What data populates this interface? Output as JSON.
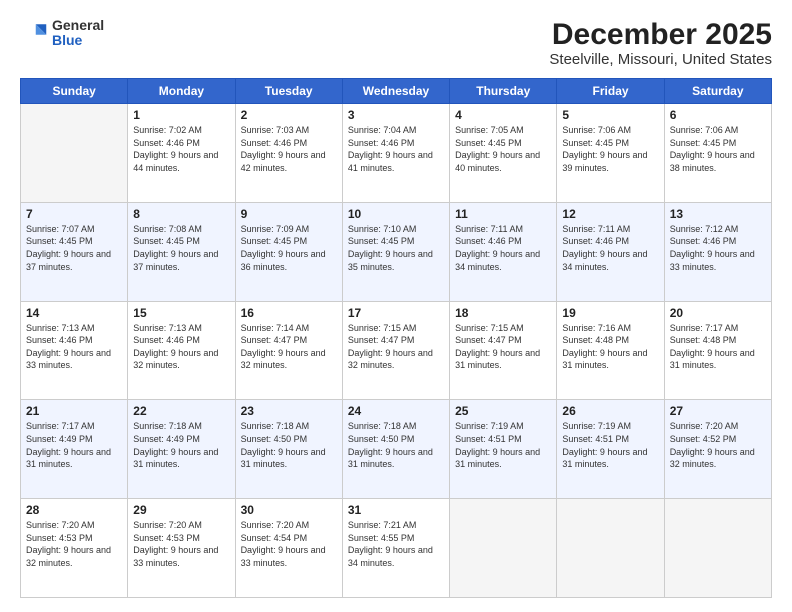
{
  "header": {
    "logo_general": "General",
    "logo_blue": "Blue",
    "title": "December 2025",
    "subtitle": "Steelville, Missouri, United States"
  },
  "days_of_week": [
    "Sunday",
    "Monday",
    "Tuesday",
    "Wednesday",
    "Thursday",
    "Friday",
    "Saturday"
  ],
  "weeks": [
    [
      {
        "day": "",
        "empty": true
      },
      {
        "day": "1",
        "sunrise": "Sunrise: 7:02 AM",
        "sunset": "Sunset: 4:46 PM",
        "daylight": "Daylight: 9 hours and 44 minutes."
      },
      {
        "day": "2",
        "sunrise": "Sunrise: 7:03 AM",
        "sunset": "Sunset: 4:46 PM",
        "daylight": "Daylight: 9 hours and 42 minutes."
      },
      {
        "day": "3",
        "sunrise": "Sunrise: 7:04 AM",
        "sunset": "Sunset: 4:46 PM",
        "daylight": "Daylight: 9 hours and 41 minutes."
      },
      {
        "day": "4",
        "sunrise": "Sunrise: 7:05 AM",
        "sunset": "Sunset: 4:45 PM",
        "daylight": "Daylight: 9 hours and 40 minutes."
      },
      {
        "day": "5",
        "sunrise": "Sunrise: 7:06 AM",
        "sunset": "Sunset: 4:45 PM",
        "daylight": "Daylight: 9 hours and 39 minutes."
      },
      {
        "day": "6",
        "sunrise": "Sunrise: 7:06 AM",
        "sunset": "Sunset: 4:45 PM",
        "daylight": "Daylight: 9 hours and 38 minutes."
      }
    ],
    [
      {
        "day": "7",
        "sunrise": "Sunrise: 7:07 AM",
        "sunset": "Sunset: 4:45 PM",
        "daylight": "Daylight: 9 hours and 37 minutes."
      },
      {
        "day": "8",
        "sunrise": "Sunrise: 7:08 AM",
        "sunset": "Sunset: 4:45 PM",
        "daylight": "Daylight: 9 hours and 37 minutes."
      },
      {
        "day": "9",
        "sunrise": "Sunrise: 7:09 AM",
        "sunset": "Sunset: 4:45 PM",
        "daylight": "Daylight: 9 hours and 36 minutes."
      },
      {
        "day": "10",
        "sunrise": "Sunrise: 7:10 AM",
        "sunset": "Sunset: 4:45 PM",
        "daylight": "Daylight: 9 hours and 35 minutes."
      },
      {
        "day": "11",
        "sunrise": "Sunrise: 7:11 AM",
        "sunset": "Sunset: 4:46 PM",
        "daylight": "Daylight: 9 hours and 34 minutes."
      },
      {
        "day": "12",
        "sunrise": "Sunrise: 7:11 AM",
        "sunset": "Sunset: 4:46 PM",
        "daylight": "Daylight: 9 hours and 34 minutes."
      },
      {
        "day": "13",
        "sunrise": "Sunrise: 7:12 AM",
        "sunset": "Sunset: 4:46 PM",
        "daylight": "Daylight: 9 hours and 33 minutes."
      }
    ],
    [
      {
        "day": "14",
        "sunrise": "Sunrise: 7:13 AM",
        "sunset": "Sunset: 4:46 PM",
        "daylight": "Daylight: 9 hours and 33 minutes."
      },
      {
        "day": "15",
        "sunrise": "Sunrise: 7:13 AM",
        "sunset": "Sunset: 4:46 PM",
        "daylight": "Daylight: 9 hours and 32 minutes."
      },
      {
        "day": "16",
        "sunrise": "Sunrise: 7:14 AM",
        "sunset": "Sunset: 4:47 PM",
        "daylight": "Daylight: 9 hours and 32 minutes."
      },
      {
        "day": "17",
        "sunrise": "Sunrise: 7:15 AM",
        "sunset": "Sunset: 4:47 PM",
        "daylight": "Daylight: 9 hours and 32 minutes."
      },
      {
        "day": "18",
        "sunrise": "Sunrise: 7:15 AM",
        "sunset": "Sunset: 4:47 PM",
        "daylight": "Daylight: 9 hours and 31 minutes."
      },
      {
        "day": "19",
        "sunrise": "Sunrise: 7:16 AM",
        "sunset": "Sunset: 4:48 PM",
        "daylight": "Daylight: 9 hours and 31 minutes."
      },
      {
        "day": "20",
        "sunrise": "Sunrise: 7:17 AM",
        "sunset": "Sunset: 4:48 PM",
        "daylight": "Daylight: 9 hours and 31 minutes."
      }
    ],
    [
      {
        "day": "21",
        "sunrise": "Sunrise: 7:17 AM",
        "sunset": "Sunset: 4:49 PM",
        "daylight": "Daylight: 9 hours and 31 minutes."
      },
      {
        "day": "22",
        "sunrise": "Sunrise: 7:18 AM",
        "sunset": "Sunset: 4:49 PM",
        "daylight": "Daylight: 9 hours and 31 minutes."
      },
      {
        "day": "23",
        "sunrise": "Sunrise: 7:18 AM",
        "sunset": "Sunset: 4:50 PM",
        "daylight": "Daylight: 9 hours and 31 minutes."
      },
      {
        "day": "24",
        "sunrise": "Sunrise: 7:18 AM",
        "sunset": "Sunset: 4:50 PM",
        "daylight": "Daylight: 9 hours and 31 minutes."
      },
      {
        "day": "25",
        "sunrise": "Sunrise: 7:19 AM",
        "sunset": "Sunset: 4:51 PM",
        "daylight": "Daylight: 9 hours and 31 minutes."
      },
      {
        "day": "26",
        "sunrise": "Sunrise: 7:19 AM",
        "sunset": "Sunset: 4:51 PM",
        "daylight": "Daylight: 9 hours and 31 minutes."
      },
      {
        "day": "27",
        "sunrise": "Sunrise: 7:20 AM",
        "sunset": "Sunset: 4:52 PM",
        "daylight": "Daylight: 9 hours and 32 minutes."
      }
    ],
    [
      {
        "day": "28",
        "sunrise": "Sunrise: 7:20 AM",
        "sunset": "Sunset: 4:53 PM",
        "daylight": "Daylight: 9 hours and 32 minutes."
      },
      {
        "day": "29",
        "sunrise": "Sunrise: 7:20 AM",
        "sunset": "Sunset: 4:53 PM",
        "daylight": "Daylight: 9 hours and 33 minutes."
      },
      {
        "day": "30",
        "sunrise": "Sunrise: 7:20 AM",
        "sunset": "Sunset: 4:54 PM",
        "daylight": "Daylight: 9 hours and 33 minutes."
      },
      {
        "day": "31",
        "sunrise": "Sunrise: 7:21 AM",
        "sunset": "Sunset: 4:55 PM",
        "daylight": "Daylight: 9 hours and 34 minutes."
      },
      {
        "day": "",
        "empty": true
      },
      {
        "day": "",
        "empty": true
      },
      {
        "day": "",
        "empty": true
      }
    ]
  ]
}
